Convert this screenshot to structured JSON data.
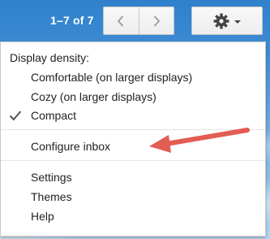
{
  "toolbar": {
    "pager_text": "1–7 of 7",
    "prev_icon": "chevron-left",
    "next_icon": "chevron-right",
    "settings_icon": "gear",
    "settings_caret_icon": "caret-down"
  },
  "menu": {
    "section_label": "Display density:",
    "density_options": [
      {
        "label": "Comfortable (on larger displays)",
        "checked": false
      },
      {
        "label": "Cozy (on larger displays)",
        "checked": false
      },
      {
        "label": "Compact",
        "checked": true
      }
    ],
    "configure_inbox": "Configure inbox",
    "items": [
      {
        "label": "Settings"
      },
      {
        "label": "Themes"
      },
      {
        "label": "Help"
      }
    ]
  },
  "annotation": {
    "arrow_color": "#e25d52"
  }
}
